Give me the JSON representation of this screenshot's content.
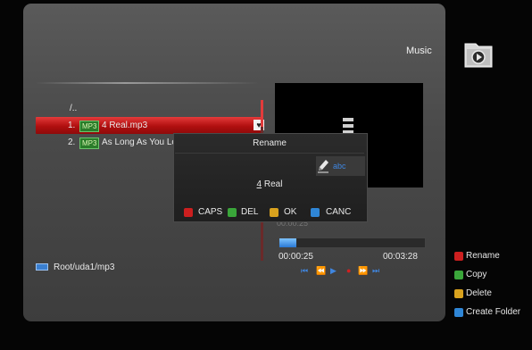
{
  "header": {
    "section_label": "Music",
    "icon": "music-folder-icon"
  },
  "file_list": {
    "items": [
      {
        "index": "",
        "badge": "",
        "name": "/.."
      },
      {
        "index": "1.",
        "badge": "MP3",
        "name": "4 Real.mp3",
        "selected": true
      },
      {
        "index": "2.",
        "badge": "MP3",
        "name": "As Long As You Lo"
      }
    ],
    "path": "Root/uda1/mp3"
  },
  "player": {
    "ghost_time": "00:00:25",
    "current_time": "00:00:25",
    "total_time": "00:03:28",
    "progress": 0.12,
    "controls": [
      "prev-icon",
      "rewind-icon",
      "play-icon",
      "record-icon",
      "fast-forward-icon",
      "next-icon"
    ]
  },
  "rename_dialog": {
    "title": "Rename",
    "input_mode": "abc",
    "value_first": "4",
    "value_rest": " Real",
    "buttons": [
      {
        "label": "CAPS",
        "color": "#cc1f1f"
      },
      {
        "label": "DEL",
        "color": "#3aa63a"
      },
      {
        "label": "OK",
        "color": "#d9a21e"
      },
      {
        "label": "CANC",
        "color": "#2f86d6"
      }
    ]
  },
  "color_legend": [
    {
      "label": "Rename",
      "color": "#cc1f1f"
    },
    {
      "label": "Copy",
      "color": "#3aa63a"
    },
    {
      "label": "Delete",
      "color": "#d9a21e"
    },
    {
      "label": "Create Folder",
      "color": "#2f86d6"
    }
  ]
}
